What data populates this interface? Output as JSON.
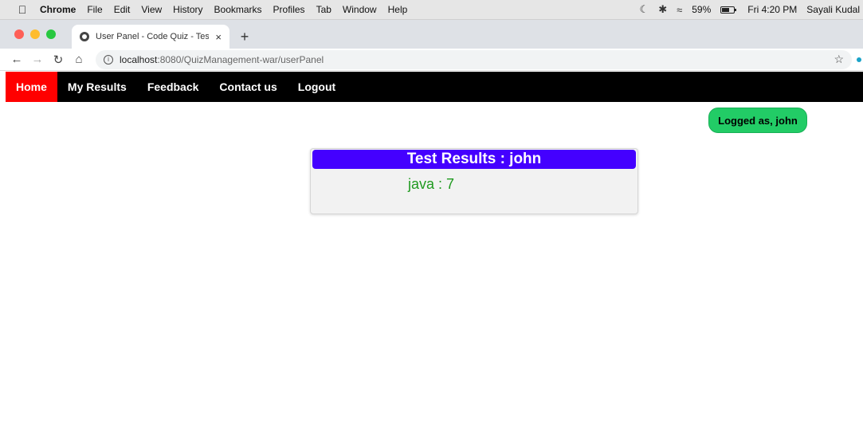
{
  "os_menubar": {
    "app_name": "Chrome",
    "menus": [
      "File",
      "Edit",
      "View",
      "History",
      "Bookmarks",
      "Profiles",
      "Tab",
      "Window",
      "Help"
    ],
    "battery_percent": "59%",
    "battery_level": 0.59,
    "clock": "Fri 4:20 PM",
    "user": "Sayali Kudal"
  },
  "browser": {
    "tab_title": "User Panel - Code Quiz - Test",
    "tab_close": "×",
    "new_tab": "+",
    "url_host": "localhost",
    "url_rest": ":8080/QuizManagement-war/userPanel"
  },
  "site_nav": {
    "items": [
      "Home",
      "My Results",
      "Feedback",
      "Contact us",
      "Logout"
    ],
    "active_index": 0,
    "active_color": "#ff0000",
    "bar_color": "#000000"
  },
  "user_badge": {
    "label": "Logged as, john",
    "color": "#22cc66"
  },
  "results": {
    "title": "Test Results : john",
    "header_color": "#4400ff",
    "line": "java : 7",
    "line_color": "#1f9a1f"
  }
}
